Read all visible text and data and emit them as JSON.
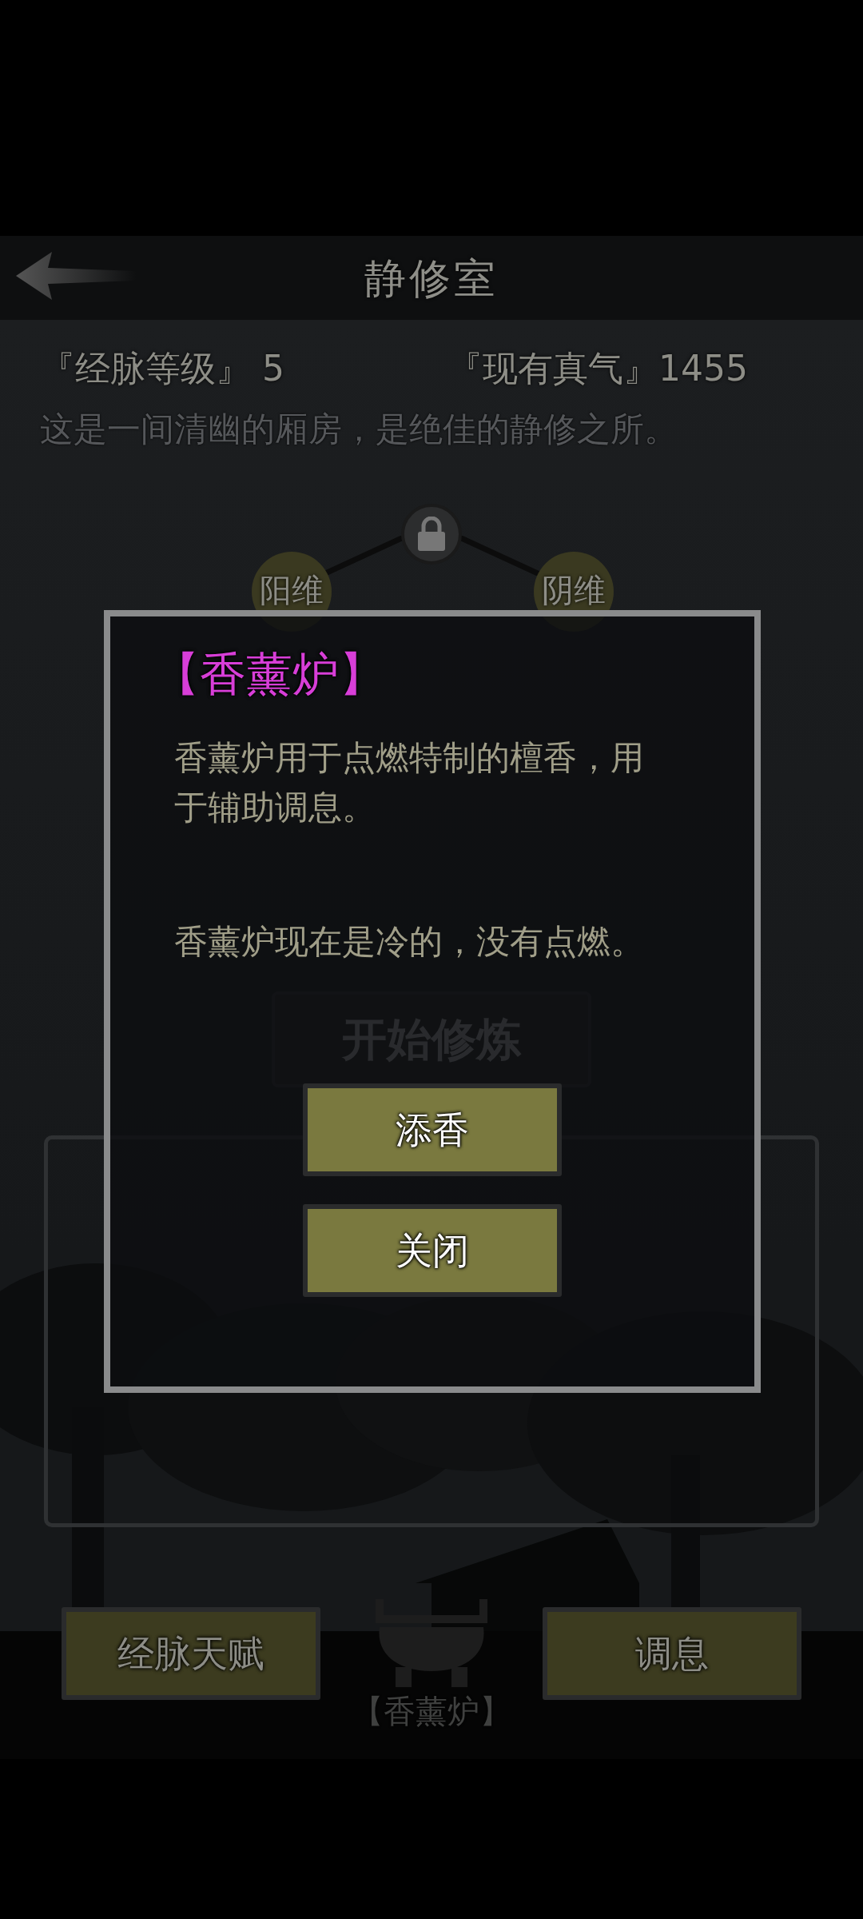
{
  "header": {
    "title": "静修室"
  },
  "stats": [
    {
      "label": "『经脉等级』",
      "value": "5"
    },
    {
      "label": "『现有真气』",
      "value": "1455"
    }
  ],
  "description": "这是一间清幽的厢房，是绝佳的静修之所。",
  "meridian": {
    "nodes": [
      {
        "label": "阳维"
      },
      {
        "label": "阴维"
      }
    ]
  },
  "start_button": {
    "label": "开始修炼"
  },
  "bottom_buttons": [
    {
      "label": "经脉天赋"
    },
    {
      "label": "调息"
    }
  ],
  "censer": {
    "label": "【香薰炉】"
  },
  "dialog": {
    "title": "【香薰炉】",
    "paragraphs": [
      "香薰炉用于点燃特制的檀香，用于辅助调息。",
      "香薰炉现在是冷的，没有点燃。"
    ],
    "buttons": [
      "添香",
      "关闭"
    ]
  }
}
